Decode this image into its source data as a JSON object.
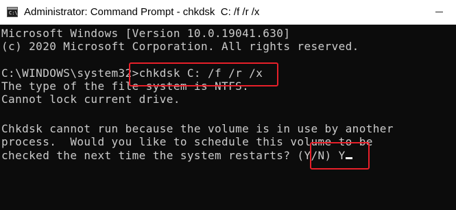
{
  "window": {
    "title": "Administrator: Command Prompt - chkdsk  C: /f /r /x",
    "icon": "cmd-icon",
    "icon_glyph": "C:\\"
  },
  "console": {
    "lines": [
      "Microsoft Windows [Version 10.0.19041.630]",
      "(c) 2020 Microsoft Corporation. All rights reserved.",
      "",
      "C:\\WINDOWS\\system32>chkdsk C: /f /r /x",
      "The type of the file system is NTFS.",
      "Cannot lock current drive.",
      "",
      "Chkdsk cannot run because the volume is in use by another",
      "process.  Would you like to schedule this volume to be",
      "checked the next time the system restarts? (Y/N) Y"
    ]
  },
  "colors": {
    "background": "#0c0c0c",
    "text": "#cccccc",
    "annotation": "#e8202a"
  }
}
